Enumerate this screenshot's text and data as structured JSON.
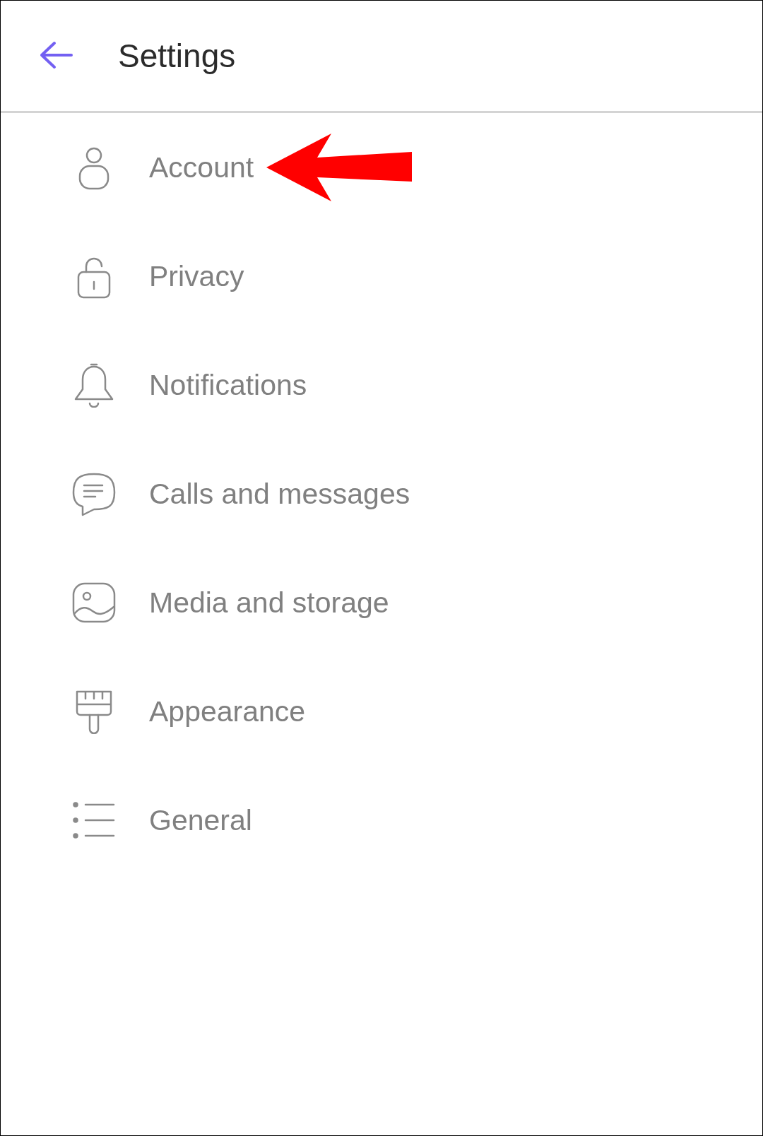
{
  "header": {
    "title": "Settings"
  },
  "items": [
    {
      "label": "Account",
      "kind": "person",
      "pointed": true
    },
    {
      "label": "Privacy",
      "kind": "lock",
      "pointed": false
    },
    {
      "label": "Notifications",
      "kind": "bell",
      "pointed": false
    },
    {
      "label": "Calls and messages",
      "kind": "chat",
      "pointed": false
    },
    {
      "label": "Media and storage",
      "kind": "image",
      "pointed": false
    },
    {
      "label": "Appearance",
      "kind": "brush",
      "pointed": false
    },
    {
      "label": "General",
      "kind": "list",
      "pointed": false
    }
  ]
}
